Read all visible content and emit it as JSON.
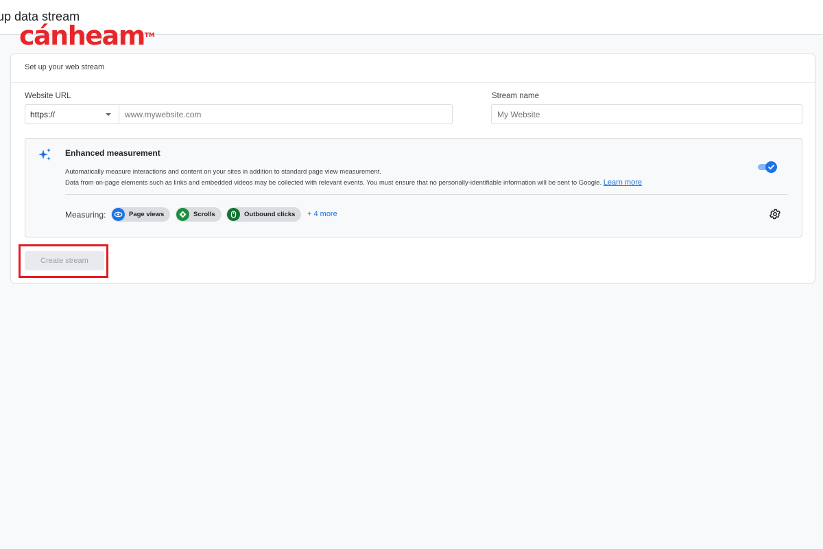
{
  "header": {
    "title": "up data stream",
    "logo_text": "cánheam",
    "logo_tm": "TM"
  },
  "card": {
    "title": "Set up your web stream"
  },
  "url": {
    "label": "Website URL",
    "protocol": "https://",
    "placeholder": "www.mywebsite.com"
  },
  "stream_name": {
    "label": "Stream name",
    "placeholder": "My Website"
  },
  "enhanced": {
    "title": "Enhanced measurement",
    "desc_line1": "Automatically measure interactions and content on your sites in addition to standard page view measurement.",
    "desc_line2": "Data from on-page elements such as links and embedded videos may be collected with relevant events. You must ensure that no personally-identifiable information will be sent to Google.",
    "learn_more": "Learn more",
    "toggle_on": true,
    "measuring_label": "Measuring:",
    "chips": [
      {
        "label": "Page views",
        "icon": "eye-icon",
        "color": "#1a73e8"
      },
      {
        "label": "Scrolls",
        "icon": "scroll-icon",
        "color": "#1e8e3e"
      },
      {
        "label": "Outbound clicks",
        "icon": "mouse-icon",
        "color": "#137333"
      }
    ],
    "more": "+ 4 more"
  },
  "actions": {
    "create_label": "Create stream"
  },
  "colors": {
    "accent": "#1a73e8",
    "logo": "#e8262a",
    "highlight": "#e21b23"
  }
}
